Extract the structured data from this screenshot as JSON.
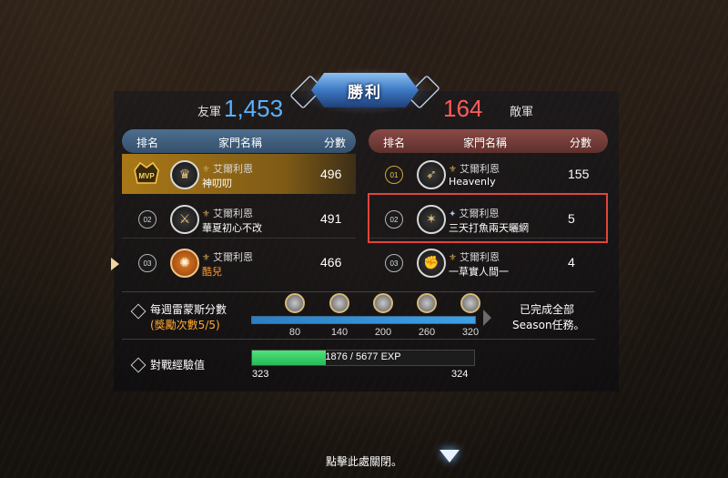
{
  "banner": {
    "title": "勝利"
  },
  "ally": {
    "label": "友軍",
    "total": "1,453",
    "headers": {
      "rank": "排名",
      "name": "家門名稱",
      "score": "分數"
    },
    "rows": [
      {
        "rank": "MVP",
        "guild": "艾爾利恩",
        "family": "神叨叨",
        "score": "496",
        "crest": "crown-crest-icon"
      },
      {
        "rank": "02",
        "guild": "艾爾利恩",
        "family": "華夏初心不改",
        "score": "491",
        "crest": "crossed-weapons-crest-icon"
      },
      {
        "rank": "03",
        "guild": "艾爾利恩",
        "family": "酷兒",
        "score": "466",
        "crest": "sun-crest-icon"
      }
    ]
  },
  "enemy": {
    "label": "敵軍",
    "total": "164",
    "headers": {
      "rank": "排名",
      "name": "家門名稱",
      "score": "分數"
    },
    "rows": [
      {
        "rank": "01",
        "guild": "艾爾利恩",
        "family": "Heavenly",
        "score": "155",
        "crest": "spear-crest-icon"
      },
      {
        "rank": "02",
        "guild": "艾爾利恩",
        "family": "三天打魚兩天曬網",
        "score": "5",
        "crest": "star-crest-icon"
      },
      {
        "rank": "03",
        "guild": "艾爾利恩",
        "family": "一草實人間一",
        "score": "4",
        "crest": "fist-crest-icon"
      }
    ]
  },
  "weekly": {
    "label": "每週雷蒙斯分數",
    "sub": "(獎勵次數5/5)",
    "progress_fraction": 1.0,
    "ticks": [
      "80",
      "140",
      "200",
      "260",
      "320"
    ],
    "done_line1": "已完成全部",
    "done_line2": "Season任務。"
  },
  "exp": {
    "label": "對戰經驗值",
    "text": "1876 / 5677 EXP",
    "current": 1876,
    "max": 5677,
    "level_from": "323",
    "level_to": "324"
  },
  "close": {
    "text": "點擊此處關閉。"
  },
  "colors": {
    "ally": "#5ab2ff",
    "enemy": "#ff5b5b",
    "highlight": "#e0453c",
    "exp": "#3ecb67"
  }
}
